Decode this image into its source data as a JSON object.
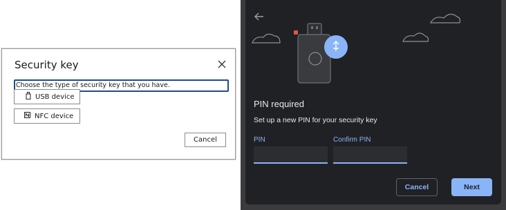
{
  "left_dialog": {
    "title": "Security key",
    "prompt": "Choose the type of security key that you have.",
    "options": [
      {
        "label": "USB device",
        "icon": "usb-key-icon"
      },
      {
        "label": "NFC device",
        "icon": "nfc-icon"
      }
    ],
    "cancel_label": "Cancel",
    "close_icon": "close-icon"
  },
  "right_dialog": {
    "title": "PIN required",
    "subtitle": "Set up a new PIN for your security key",
    "pin_label": "PIN",
    "pin_value": "",
    "confirm_label": "Confirm PIN",
    "confirm_value": "",
    "cancel_label": "Cancel",
    "next_label": "Next",
    "back_icon": "back-arrow-icon",
    "illustration": "security-key-usb-illustration",
    "accent_color": "#8ab4f8",
    "background_color": "#202124"
  }
}
